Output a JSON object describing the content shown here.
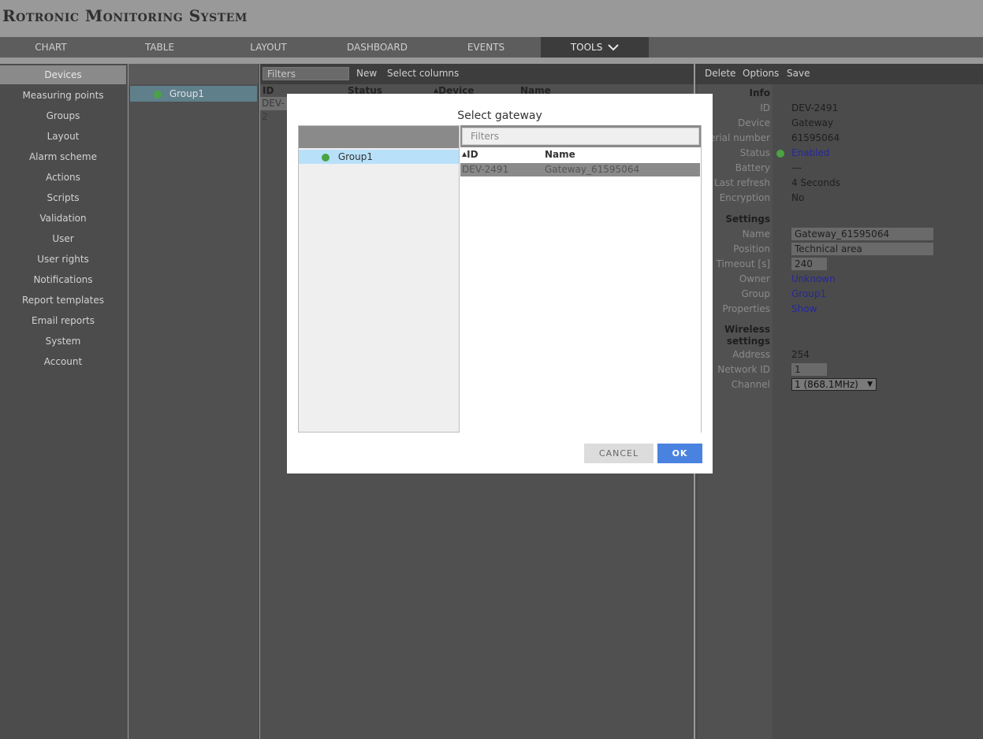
{
  "app": {
    "title": "Rotronic Monitoring System"
  },
  "nav": {
    "tabs": [
      {
        "label": "CHART"
      },
      {
        "label": "TABLE"
      },
      {
        "label": "LAYOUT"
      },
      {
        "label": "DASHBOARD"
      },
      {
        "label": "EVENTS"
      },
      {
        "label": "TOOLS"
      }
    ],
    "active": "TOOLS"
  },
  "sidebar": {
    "items": [
      {
        "label": "Devices"
      },
      {
        "label": "Measuring points"
      },
      {
        "label": "Groups"
      },
      {
        "label": "Layout"
      },
      {
        "label": "Alarm scheme"
      },
      {
        "label": "Actions"
      },
      {
        "label": "Scripts"
      },
      {
        "label": "Validation"
      },
      {
        "label": "User"
      },
      {
        "label": "User rights"
      },
      {
        "label": "Notifications"
      },
      {
        "label": "Report templates"
      },
      {
        "label": "Email reports"
      },
      {
        "label": "System"
      },
      {
        "label": "Account"
      }
    ],
    "active": "Devices"
  },
  "groups": {
    "items": [
      {
        "label": "Group1"
      }
    ]
  },
  "device_list": {
    "filter_placeholder": "Filters",
    "new_label": "New",
    "select_columns_label": "Select columns",
    "columns": [
      "ID",
      "Status",
      "Device",
      "Name"
    ],
    "rows": [
      {
        "id_partial": "DEV-2"
      }
    ]
  },
  "details": {
    "toolbar": {
      "delete": "Delete",
      "options": "Options",
      "save": "Save"
    },
    "info_title": "Info",
    "id_label": "ID",
    "id_value": "DEV-2491",
    "device_label": "Device",
    "device_value": "Gateway",
    "serial_label": "Serial number",
    "serial_value": "61595064",
    "status_label": "Status",
    "status_value": "Enabled",
    "battery_label": "Battery",
    "battery_value": "---",
    "last_refresh_label": "Last refresh",
    "last_refresh_value": "4 Seconds",
    "encryption_label": "Encryption",
    "encryption_value": "No",
    "settings_title": "Settings",
    "name_label": "Name",
    "name_value": "Gateway_61595064",
    "position_label": "Position",
    "position_value": "Technical area",
    "timeout_label": "Timeout [s]",
    "timeout_value": "240",
    "owner_label": "Owner",
    "owner_value": "Unknown",
    "group_label": "Group",
    "group_value": "Group1",
    "properties_label": "Properties",
    "properties_value": "Show",
    "wireless_title_1": "Wireless",
    "wireless_title_2": "settings",
    "address_label": "Address",
    "address_value": "254",
    "network_id_label": "Network ID",
    "network_id_value": "1",
    "channel_label": "Channel",
    "channel_value": "1 (868.1MHz)"
  },
  "dialog": {
    "title": "Select gateway",
    "tree": [
      {
        "label": "Group1"
      }
    ],
    "filter_placeholder": "Filters",
    "columns": [
      "ID",
      "Name"
    ],
    "rows": [
      {
        "id": "DEV-2491",
        "name": "Gateway_61595064"
      }
    ],
    "cancel_label": "CANCEL",
    "ok_label": "OK"
  },
  "colors": {
    "status_green": "#4aa344",
    "ok_blue": "#4a82e0",
    "link_blue": "#27289a",
    "selected_row": "#b8e1f9"
  }
}
